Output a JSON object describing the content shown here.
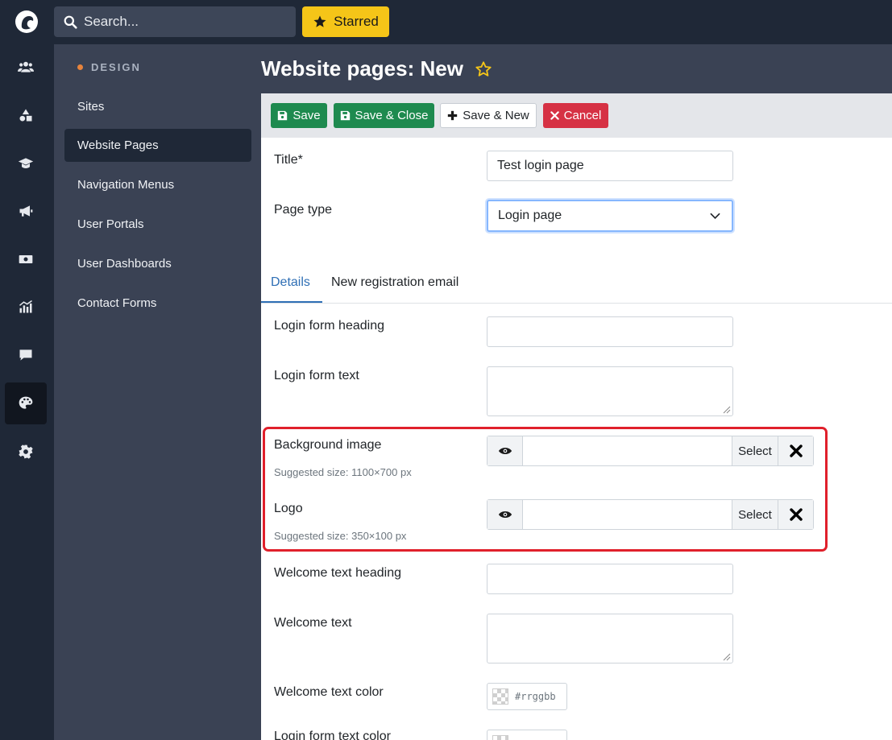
{
  "topbar": {
    "search_placeholder": "Search...",
    "starred_label": "Starred"
  },
  "rail": {
    "items": [
      "users-icon",
      "shapes-icon",
      "graduation-cap-icon",
      "megaphone-icon",
      "money-icon",
      "chart-icon",
      "comment-icon",
      "palette-icon",
      "gear-icon"
    ],
    "active": "palette-icon"
  },
  "sidebar": {
    "section_title": "DESIGN",
    "items": [
      "Sites",
      "Website Pages",
      "Navigation Menus",
      "User Portals",
      "User Dashboards",
      "Contact Forms"
    ],
    "active": "Website Pages"
  },
  "page": {
    "title": "Website pages: New"
  },
  "toolbar": {
    "save": "Save",
    "save_close": "Save & Close",
    "save_new": "Save & New",
    "cancel": "Cancel"
  },
  "form": {
    "title_label": "Title*",
    "title_value": "Test login page",
    "page_type_label": "Page type",
    "page_type_value": "Login page",
    "tabs": [
      "Details",
      "New registration email"
    ],
    "active_tab": "Details",
    "login_form_heading_label": "Login form heading",
    "login_form_text_label": "Login form text",
    "background_image_label": "Background image",
    "background_image_hint": "Suggested size: 1100×700 px",
    "logo_label": "Logo",
    "logo_hint": "Suggested size: 350×100 px",
    "select_label": "Select",
    "welcome_text_heading_label": "Welcome text heading",
    "welcome_text_label": "Welcome text",
    "welcome_text_color_label": "Welcome text color",
    "color_placeholder": "#rrggbb",
    "login_form_text_color_label": "Login form text color"
  },
  "colors": {
    "topbar": "#1f2837",
    "sidebar": "#3a4254",
    "save_green": "#1e8a4f",
    "cancel_red": "#d63144",
    "starred_yellow": "#f5c518",
    "tab_blue": "#2f6fb5",
    "highlight_red": "#e0202b"
  }
}
